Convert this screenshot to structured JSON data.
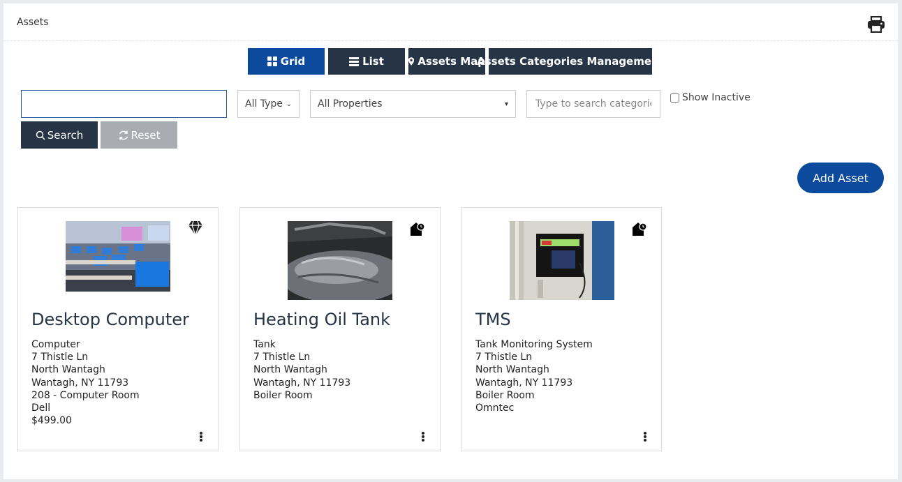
{
  "panel": {
    "title": "Assets"
  },
  "views": [
    {
      "label": "Grid",
      "icon": "grid-icon",
      "active": true
    },
    {
      "label": "List",
      "icon": "list-icon"
    },
    {
      "label": "Assets Map",
      "icon": "map-marker-icon"
    },
    {
      "label": "Assets Categories Management"
    }
  ],
  "filters": {
    "search_value": "",
    "type_selected": "All Type",
    "property_selected": "All Properties",
    "category_placeholder": "Type to search categories",
    "show_inactive_label": "Show Inactive",
    "show_inactive_checked": false
  },
  "actions": {
    "search_label": "Search",
    "reset_label": "Reset",
    "add_asset_label": "Add Asset"
  },
  "colors": {
    "primary": "#0b4a9c",
    "dark": "#263446",
    "muted": "#a9adb2"
  },
  "cards": [
    {
      "title": "Desktop Computer",
      "badge_icon": "diamond-icon",
      "image": "computer-lab-photo",
      "lines": [
        "Computer",
        "7 Thistle Ln",
        "North Wantagh",
        "Wantagh, NY 11793",
        "208 - Computer Room",
        "Dell",
        "$499.00"
      ]
    },
    {
      "title": "Heating Oil Tank",
      "badge_icon": "house-clock-icon",
      "image": "oil-tank-photo",
      "lines": [
        "Tank",
        "7 Thistle Ln",
        "North Wantagh",
        "Wantagh, NY 11793",
        "Boiler Room"
      ]
    },
    {
      "title": "TMS",
      "badge_icon": "house-clock-icon",
      "image": "tank-monitor-photo",
      "lines": [
        "Tank Monitoring System",
        "7 Thistle Ln",
        "North Wantagh",
        "Wantagh, NY 11793",
        "Boiler Room",
        "Omntec"
      ]
    }
  ]
}
